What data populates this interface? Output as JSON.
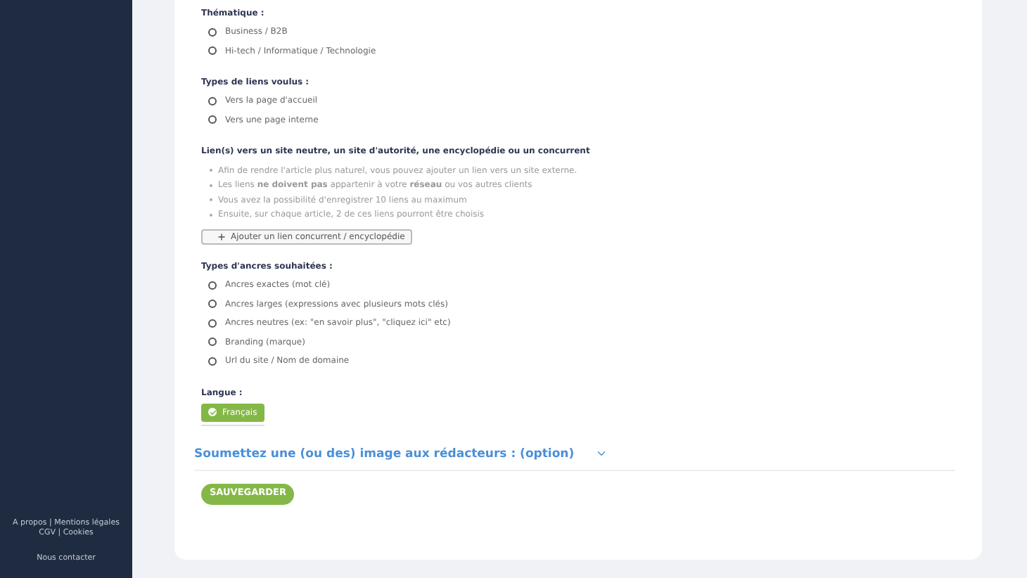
{
  "sidebar": {
    "footer_links": [
      "A propos | Mentions légales",
      "CGV | Cookies"
    ],
    "contact": "Nous contacter"
  },
  "form": {
    "sections": [
      {
        "kind": "radio",
        "label": "Thématique :",
        "options": [
          {
            "label": "Business / B2B",
            "selected": false
          },
          {
            "label": "Hi-tech / Informatique / Technologie",
            "selected": false
          }
        ]
      },
      {
        "kind": "radio",
        "label": "Types de liens voulus :",
        "options": [
          {
            "label": "Vers la page d'accueil",
            "selected": false
          },
          {
            "label": "Vers une page interne",
            "selected": false
          }
        ]
      },
      {
        "kind": "links",
        "label": "Lien(s) vers un site neutre, un site d'autorité, une encyclopédie ou un concurrent",
        "notes": [
          "Afin de rendre l'article plus naturel, vous pouvez ajouter un lien vers un site externe.",
          "Les liens **ne doivent pas** appartenir à votre **réseau** ou vos autres clients",
          "Vous avez la possibilité d'enregistrer 10 liens au maximum",
          "Ensuite, sur chaque article, 2 de ces liens pourront être choisis"
        ],
        "add_button": "Ajouter un lien concurrent / encyclopédie"
      },
      {
        "kind": "radio",
        "label": "Types d'ancres souhaitées :",
        "options": [
          {
            "label": "Ancres exactes (mot clé)",
            "selected": false
          },
          {
            "label": "Ancres larges (expressions avec plusieurs mots clés)",
            "selected": false
          },
          {
            "label": "Ancres neutres (ex: \"en savoir plus\", \"cliquez ici\" etc)",
            "selected": false
          },
          {
            "label": "Branding (marque)",
            "selected": false
          },
          {
            "label": "Url du site / Nom de domaine",
            "selected": false
          }
        ]
      },
      {
        "kind": "chips",
        "label": "Langue :",
        "options": [
          {
            "label": "Français",
            "selected": true
          }
        ]
      }
    ],
    "collapsible": {
      "title": "Soumettez une (ou des) image aux rédacteurs : (option)",
      "expanded": false
    },
    "save_button": "SAUVEGARDER"
  }
}
